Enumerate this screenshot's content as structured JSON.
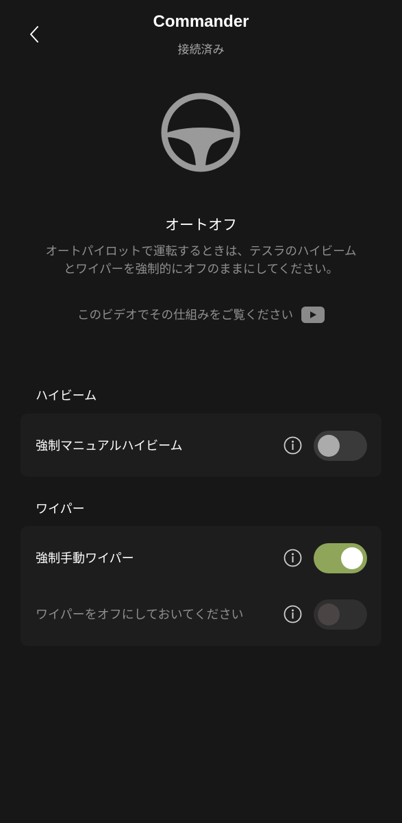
{
  "header": {
    "title": "Commander",
    "status": "接続済み"
  },
  "hero": {
    "icon": "steering-wheel-icon",
    "mode_title": "オートオフ",
    "description": "オートパイロットで運転するときは、テスラのハイビームとワイパーを強制的にオフのままにしてください。",
    "video_link": "このビデオでその仕組みをご覧ください"
  },
  "sections": {
    "highbeam": {
      "label": "ハイビーム",
      "rows": [
        {
          "label": "強制マニュアルハイビーム",
          "toggle": "off"
        }
      ]
    },
    "wiper": {
      "label": "ワイパー",
      "rows": [
        {
          "label": "強制手動ワイパー",
          "toggle": "on"
        },
        {
          "label": "ワイパーをオフにしておいてください",
          "toggle": "off-disabled"
        }
      ]
    }
  },
  "colors": {
    "background": "#171717",
    "card": "#1d1d1d",
    "toggle_on": "#8fa65a",
    "toggle_off": "#3a3a3a",
    "text_secondary": "#8f8f8f"
  }
}
